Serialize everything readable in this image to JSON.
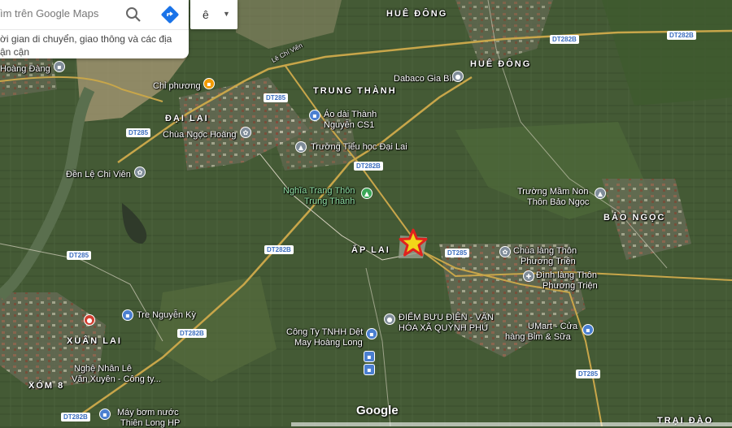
{
  "search": {
    "placeholder": "ìm trên Google Maps",
    "hint_line1": "ời gian di chuyển, giao thông và các địa",
    "hint_line2": "ận cận"
  },
  "language": {
    "letter": "ê"
  },
  "areas": {
    "hue_dong_top": "HUÊ ĐÔNG",
    "hue_dong": "HUÊ ĐÔNG",
    "trung_thanh": "TRUNG THÀNH",
    "dai_lai": "ĐẠI LAI",
    "ap_lai": "ẤP LAI",
    "bao_ngoc": "BẢO NGỌC",
    "xuan_lai": "XUÂN LAI",
    "xom_8": "XÓM 8",
    "trai_dao": "TRẠI ĐÀO"
  },
  "streets": {
    "le_chi_vien": "Lê Chí Viên"
  },
  "roads": {
    "dt282b_tr": "DT282B",
    "dt282b_1": "DT282B",
    "dt282b_2": "DT282B",
    "dt282b_3": "DT282B",
    "dt282b_4": "DT282B",
    "dt285_1": "DT285",
    "dt285_2": "DT285",
    "dt285_3": "DT285",
    "dt285_4": "DT285",
    "dt285_5": "DT285"
  },
  "pois": {
    "hoang_dang": "Hoàng Đàng",
    "chi_phuong": "Chỉ phương",
    "dabaco": "Dabaco Gia Bình",
    "ao_dai_1": "Áo dài Thành",
    "ao_dai_2": "Nguyễn CS1",
    "chua_ngoc_hoang": "Chùa Ngọc Hoàng",
    "truong_tieu_hoc": "Trường Tiểu học Đại Lai",
    "den_le_chi_vien": "Đền Lệ Chi Viên",
    "nghia_trang_1": "Nghĩa Trang Thôn",
    "nghia_trang_2": "Trung Thành",
    "mam_non_1": "Trường Mầm Non",
    "mam_non_2": "Thôn Bảo Ngọc",
    "chua_lang_1": "Chùa làng Thôn",
    "chua_lang_2": "Phương Triện",
    "dinh_lang_1": "Đình làng Thôn",
    "dinh_lang_2": "Phương Triện",
    "buu_dien_1": "ĐIỂM BƯU ĐIỆN - VĂN",
    "buu_dien_2": "HÓA XÃ QUỲNH PHÚ",
    "umart_1": "UMart - Cửa",
    "umart_2": "hàng Bỉm & Sữa",
    "cong_ty_1": "Công Ty TNHH Dệt",
    "cong_ty_2": "May Hoàng Long",
    "tre_nguyen_ky": "Tre Nguyễn Kỳ",
    "nghe_nhan_1": "Nghệ Nhân Lê",
    "nghe_nhan_2": "Văn Xuyên - Công ty...",
    "may_bom_1": "Máy bơm nước",
    "may_bom_2": "Thiên Long HP"
  },
  "google": "Google",
  "colors": {
    "satellite_base": "#3d5230",
    "road": "#c8a64a",
    "river": "#5a6f4e",
    "marker_star": "#f2d619",
    "marker_outline": "#e0221e",
    "pin_blue": "#4a7fd0",
    "pin_gray": "#7f8c99",
    "pin_green": "#3aa757",
    "pin_orange": "#f29a00",
    "pin_red": "#d23f31"
  },
  "icons": [
    "search-icon",
    "directions-icon",
    "dropdown-icon",
    "location-pin-icon",
    "shop-icon",
    "education-icon",
    "temple-icon",
    "church-icon",
    "cemetery-icon",
    "bus-stop-icon",
    "star-marker-icon"
  ]
}
